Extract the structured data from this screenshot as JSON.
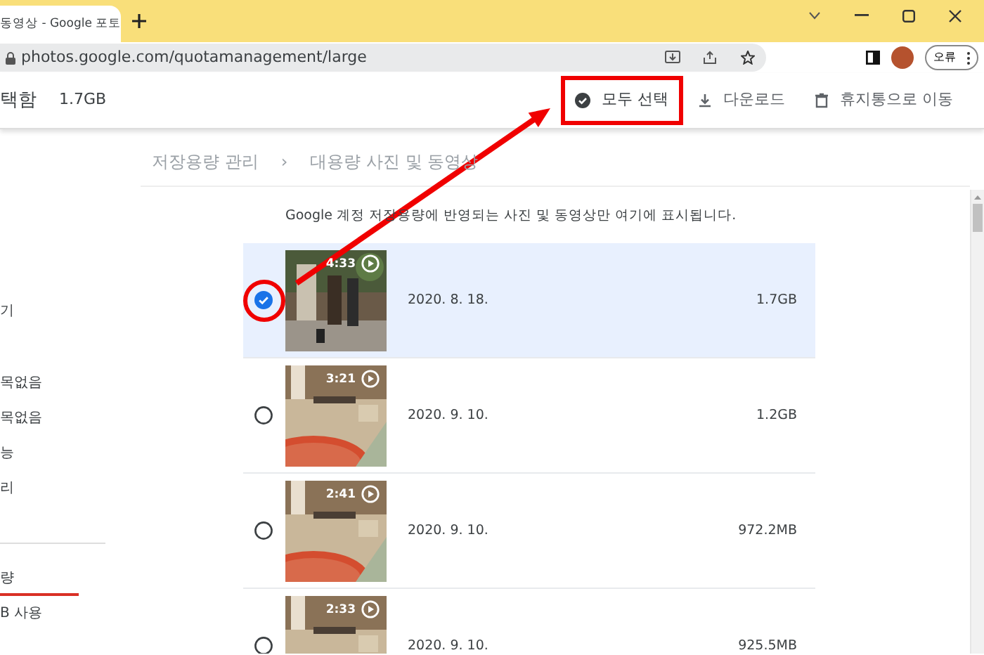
{
  "browser": {
    "tab_title": "동영상 - Google 포토",
    "address": "photos.google.com/quotamanagement/large",
    "profile_button": "오류"
  },
  "header": {
    "selection_label": "택함",
    "selection_size": "1.7GB",
    "actions": [
      {
        "kind": "select-all",
        "label": "모두 선택",
        "highlighted": true
      },
      {
        "kind": "download",
        "label": "다운로드",
        "highlighted": false
      },
      {
        "kind": "trash",
        "label": "휴지통으로 이동",
        "highlighted": false
      }
    ]
  },
  "sidebar": {
    "groups": [
      [
        {
          "label": "기",
          "selected": false
        }
      ],
      [
        {
          "label": "목없음",
          "selected": false
        },
        {
          "label": "목없음",
          "selected": false
        },
        {
          "label": "능",
          "selected": false
        },
        {
          "label": "리",
          "selected": false
        }
      ],
      [
        {
          "label": "량",
          "selected": true
        },
        {
          "label": "B 사용",
          "selected": false
        }
      ]
    ]
  },
  "breadcrumb": [
    "저장용량 관리",
    "›",
    "대용량 사진 및 동영상"
  ],
  "description": "Google 계정 저장용량에 반영되는 사진 및 동영상만 여기에 표시됩니다.",
  "rows": [
    {
      "duration": "4:33",
      "date": "2020. 8. 18.",
      "size": "1.7GB",
      "selected": true,
      "highlighted": true
    },
    {
      "duration": "3:21",
      "date": "2020. 9. 10.",
      "size": "1.2GB",
      "selected": false,
      "highlighted": false
    },
    {
      "duration": "2:41",
      "date": "2020. 9. 10.",
      "size": "972.2MB",
      "selected": false,
      "highlighted": false
    },
    {
      "duration": "2:33",
      "date": "2020. 9. 10.",
      "size": "925.5MB",
      "selected": false,
      "highlighted": false
    }
  ]
}
